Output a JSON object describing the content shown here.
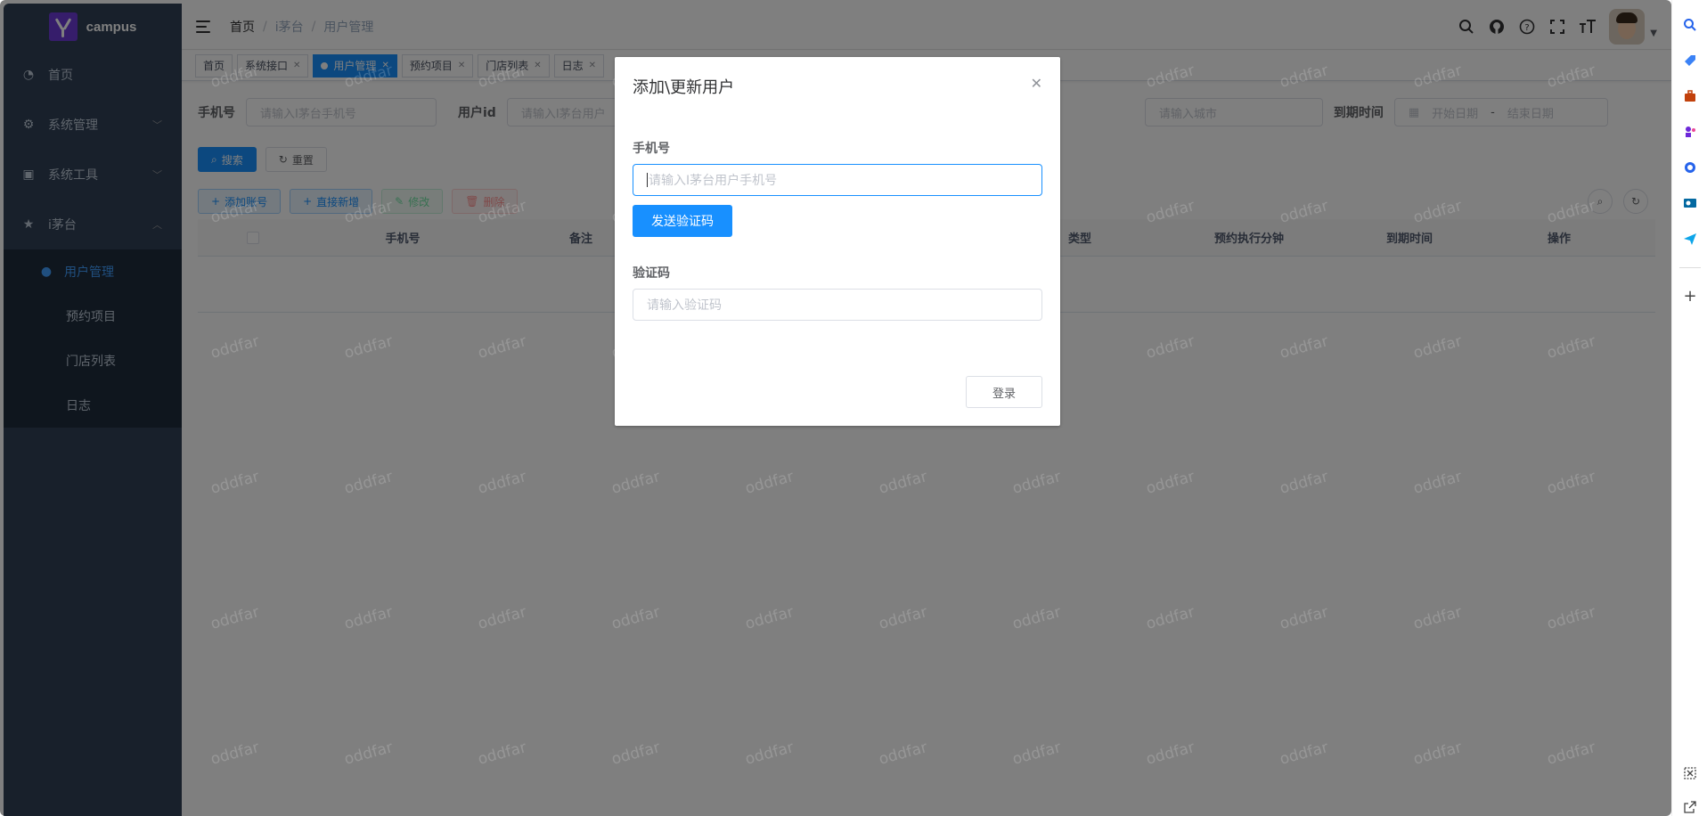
{
  "app": {
    "logo_text": "campus"
  },
  "sidebar": {
    "items": [
      {
        "label": "首页",
        "icon": "dashboard-icon"
      },
      {
        "label": "系统管理",
        "icon": "gear-icon"
      },
      {
        "label": "系统工具",
        "icon": "toolbox-icon"
      },
      {
        "label": "i茅台",
        "icon": "star-icon"
      }
    ],
    "sub_items": [
      {
        "label": "用户管理",
        "icon": "user-icon"
      },
      {
        "label": "预约项目"
      },
      {
        "label": "门店列表"
      },
      {
        "label": "日志"
      }
    ]
  },
  "breadcrumb": [
    "首页",
    "i茅台",
    "用户管理"
  ],
  "tags": [
    "首页",
    "系统接口",
    "用户管理",
    "预约项目",
    "门店列表",
    "日志"
  ],
  "search": {
    "phone_label": "手机号",
    "phone_placeholder": "请输入I茅台手机号",
    "userid_label": "用户id",
    "userid_placeholder": "请输入I茅台用户",
    "city_placeholder": "请输入城市",
    "expire_label": "到期时间",
    "start_placeholder": "开始日期",
    "range_sep": "-",
    "end_placeholder": "结束日期",
    "search_btn": "搜索",
    "reset_btn": "重置"
  },
  "toolbar": {
    "add_account": "添加账号",
    "direct_add": "直接新增",
    "edit": "修改",
    "delete": "删除"
  },
  "table": {
    "columns": [
      "手机号",
      "备注",
      "类型",
      "预约执行分钟",
      "到期时间",
      "操作"
    ]
  },
  "dialog": {
    "title": "添加\\更新用户",
    "phone_label": "手机号",
    "phone_placeholder": "请输入I茅台用户手机号",
    "send_code_btn": "发送验证码",
    "code_label": "验证码",
    "code_placeholder": "请输入验证码",
    "login_btn": "登录"
  },
  "watermark": "oddfar"
}
